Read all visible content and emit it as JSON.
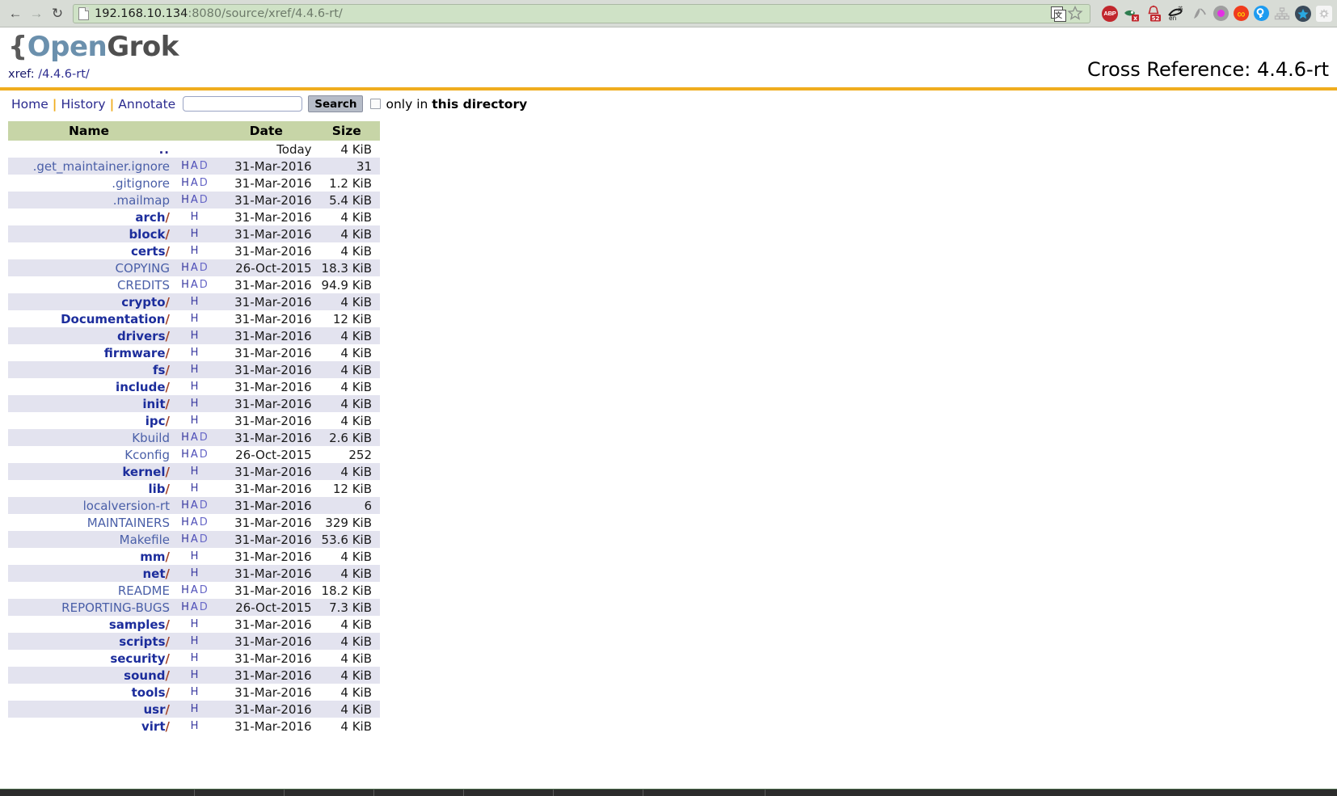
{
  "browser": {
    "back_icon": "back-arrow-icon",
    "forward_icon": "forward-arrow-icon",
    "reload_icon": "reload-icon",
    "url": "192.168.10.134",
    "url_rest": ":8080/source/xref/4.4.6-rt/",
    "extensions": [
      {
        "name": "translate-icon",
        "label": ""
      },
      {
        "name": "bookmark-star-icon",
        "label": ""
      },
      {
        "name": "adblock-plus-icon",
        "label": "ABP"
      },
      {
        "name": "ghostery-icon",
        "label": "x"
      },
      {
        "name": "notification-bell-icon",
        "label": "52"
      },
      {
        "name": "translate-en-icon",
        "label": "en"
      },
      {
        "name": "brush-icon",
        "label": ""
      },
      {
        "name": "gray-dot-icon",
        "label": ""
      },
      {
        "name": "infinity-icon",
        "label": "∞"
      },
      {
        "name": "key-search-icon",
        "label": ""
      },
      {
        "name": "sitemap-icon",
        "label": ""
      },
      {
        "name": "blue-star-icon",
        "label": ""
      },
      {
        "name": "settings-gear-icon",
        "label": ""
      }
    ]
  },
  "header": {
    "logo_brace": "{",
    "logo_open": "Open",
    "logo_grok": "Grok",
    "xref_label": "xref: ",
    "xref_path": "/4.4.6-rt/",
    "cross_reference": "Cross Reference: 4.4.6-rt"
  },
  "nav": {
    "home": "Home",
    "history": "History",
    "annotate": "Annotate",
    "separator": "|",
    "search_value": "",
    "search_placeholder": "",
    "search_button": "Search",
    "only_in_prefix": "only in ",
    "only_in_strong": "this directory",
    "checkbox_checked": false
  },
  "table": {
    "columns": [
      "Name",
      "",
      "Date",
      "Size"
    ],
    "rows": [
      {
        "name": "..",
        "type": "updir",
        "links": [],
        "date": "Today",
        "size": "4 KiB"
      },
      {
        "name": ".get_maintainer.ignore",
        "type": "file",
        "links": [
          "H",
          "A",
          "D"
        ],
        "date": "31-Mar-2016",
        "size": "31"
      },
      {
        "name": ".gitignore",
        "type": "file",
        "links": [
          "H",
          "A",
          "D"
        ],
        "date": "31-Mar-2016",
        "size": "1.2 KiB"
      },
      {
        "name": ".mailmap",
        "type": "file",
        "links": [
          "H",
          "A",
          "D"
        ],
        "date": "31-Mar-2016",
        "size": "5.4 KiB"
      },
      {
        "name": "arch",
        "type": "dir",
        "links": [
          "H"
        ],
        "date": "31-Mar-2016",
        "size": "4 KiB"
      },
      {
        "name": "block",
        "type": "dir",
        "links": [
          "H"
        ],
        "date": "31-Mar-2016",
        "size": "4 KiB"
      },
      {
        "name": "certs",
        "type": "dir",
        "links": [
          "H"
        ],
        "date": "31-Mar-2016",
        "size": "4 KiB"
      },
      {
        "name": "COPYING",
        "type": "file",
        "links": [
          "H",
          "A",
          "D"
        ],
        "date": "26-Oct-2015",
        "size": "18.3 KiB"
      },
      {
        "name": "CREDITS",
        "type": "file",
        "links": [
          "H",
          "A",
          "D"
        ],
        "date": "31-Mar-2016",
        "size": "94.9 KiB"
      },
      {
        "name": "crypto",
        "type": "dir",
        "links": [
          "H"
        ],
        "date": "31-Mar-2016",
        "size": "4 KiB"
      },
      {
        "name": "Documentation",
        "type": "dir",
        "links": [
          "H"
        ],
        "date": "31-Mar-2016",
        "size": "12 KiB"
      },
      {
        "name": "drivers",
        "type": "dir",
        "links": [
          "H"
        ],
        "date": "31-Mar-2016",
        "size": "4 KiB"
      },
      {
        "name": "firmware",
        "type": "dir",
        "links": [
          "H"
        ],
        "date": "31-Mar-2016",
        "size": "4 KiB"
      },
      {
        "name": "fs",
        "type": "dir",
        "links": [
          "H"
        ],
        "date": "31-Mar-2016",
        "size": "4 KiB"
      },
      {
        "name": "include",
        "type": "dir",
        "links": [
          "H"
        ],
        "date": "31-Mar-2016",
        "size": "4 KiB"
      },
      {
        "name": "init",
        "type": "dir",
        "links": [
          "H"
        ],
        "date": "31-Mar-2016",
        "size": "4 KiB"
      },
      {
        "name": "ipc",
        "type": "dir",
        "links": [
          "H"
        ],
        "date": "31-Mar-2016",
        "size": "4 KiB"
      },
      {
        "name": "Kbuild",
        "type": "file",
        "links": [
          "H",
          "A",
          "D"
        ],
        "date": "31-Mar-2016",
        "size": "2.6 KiB"
      },
      {
        "name": "Kconfig",
        "type": "file",
        "links": [
          "H",
          "A",
          "D"
        ],
        "date": "26-Oct-2015",
        "size": "252"
      },
      {
        "name": "kernel",
        "type": "dir",
        "links": [
          "H"
        ],
        "date": "31-Mar-2016",
        "size": "4 KiB"
      },
      {
        "name": "lib",
        "type": "dir",
        "links": [
          "H"
        ],
        "date": "31-Mar-2016",
        "size": "12 KiB"
      },
      {
        "name": "localversion-rt",
        "type": "file",
        "links": [
          "H",
          "A",
          "D"
        ],
        "date": "31-Mar-2016",
        "size": "6"
      },
      {
        "name": "MAINTAINERS",
        "type": "file",
        "links": [
          "H",
          "A",
          "D"
        ],
        "date": "31-Mar-2016",
        "size": "329 KiB"
      },
      {
        "name": "Makefile",
        "type": "file",
        "links": [
          "H",
          "A",
          "D"
        ],
        "date": "31-Mar-2016",
        "size": "53.6 KiB"
      },
      {
        "name": "mm",
        "type": "dir",
        "links": [
          "H"
        ],
        "date": "31-Mar-2016",
        "size": "4 KiB"
      },
      {
        "name": "net",
        "type": "dir",
        "links": [
          "H"
        ],
        "date": "31-Mar-2016",
        "size": "4 KiB"
      },
      {
        "name": "README",
        "type": "file",
        "links": [
          "H",
          "A",
          "D"
        ],
        "date": "31-Mar-2016",
        "size": "18.2 KiB"
      },
      {
        "name": "REPORTING-BUGS",
        "type": "file",
        "links": [
          "H",
          "A",
          "D"
        ],
        "date": "26-Oct-2015",
        "size": "7.3 KiB"
      },
      {
        "name": "samples",
        "type": "dir",
        "links": [
          "H"
        ],
        "date": "31-Mar-2016",
        "size": "4 KiB"
      },
      {
        "name": "scripts",
        "type": "dir",
        "links": [
          "H"
        ],
        "date": "31-Mar-2016",
        "size": "4 KiB"
      },
      {
        "name": "security",
        "type": "dir",
        "links": [
          "H"
        ],
        "date": "31-Mar-2016",
        "size": "4 KiB"
      },
      {
        "name": "sound",
        "type": "dir",
        "links": [
          "H"
        ],
        "date": "31-Mar-2016",
        "size": "4 KiB"
      },
      {
        "name": "tools",
        "type": "dir",
        "links": [
          "H"
        ],
        "date": "31-Mar-2016",
        "size": "4 KiB"
      },
      {
        "name": "usr",
        "type": "dir",
        "links": [
          "H"
        ],
        "date": "31-Mar-2016",
        "size": "4 KiB"
      },
      {
        "name": "virt",
        "type": "dir",
        "links": [
          "H"
        ],
        "date": "31-Mar-2016",
        "size": "4 KiB"
      }
    ]
  },
  "colors": {
    "accent_rule": "#f0ad1e",
    "table_header_bg": "#c7d5a7",
    "row_alt_bg": "#e3e3ef",
    "dir_link": "#1c2d9c",
    "file_link": "#4a5fa8",
    "slash": "#a2452a",
    "url_bar_bg": "#cfe2c6"
  }
}
